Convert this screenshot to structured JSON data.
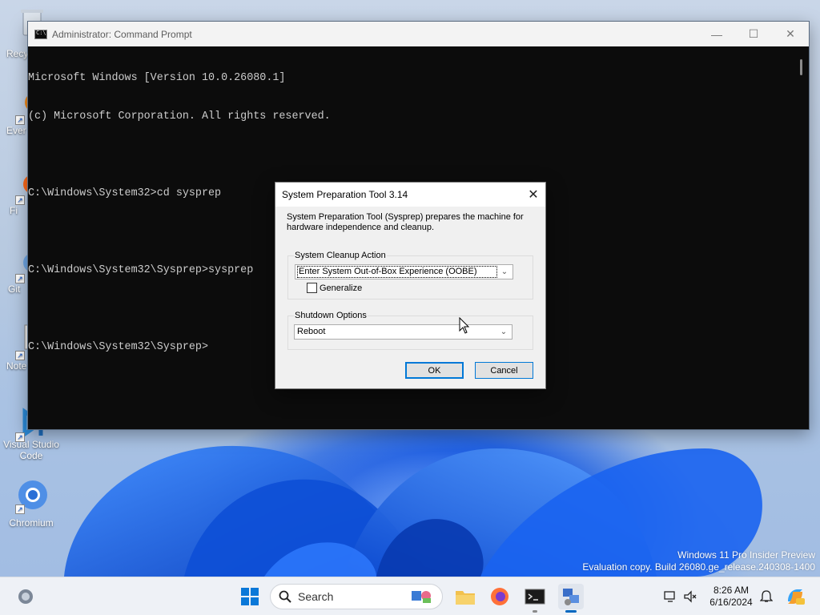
{
  "desktop": {
    "icons": [
      {
        "id": "recycle",
        "label": "Recy"
      },
      {
        "id": "everything",
        "label": "Ever"
      },
      {
        "id": "firefox",
        "label": "Fi"
      },
      {
        "id": "git",
        "label": "Git"
      },
      {
        "id": "notepad",
        "label": "Note"
      },
      {
        "id": "vscode",
        "label": "Visual Studio\nCode"
      },
      {
        "id": "chromium",
        "label": "Chromium"
      }
    ],
    "watermark_line1": "Windows 11 Pro Insider Preview",
    "watermark_line2": "Evaluation copy. Build 26080.ge_release.240308-1400"
  },
  "cmd": {
    "title": "Administrator: Command Prompt",
    "lines": [
      "Microsoft Windows [Version 10.0.26080.1]",
      "(c) Microsoft Corporation. All rights reserved.",
      "",
      "C:\\Windows\\System32>cd sysprep",
      "",
      "C:\\Windows\\System32\\Sysprep>sysprep",
      "",
      "C:\\Windows\\System32\\Sysprep>"
    ],
    "controls": {
      "minimize": "—",
      "maximize": "☐",
      "close": "✕"
    }
  },
  "sysprep": {
    "title": "System Preparation Tool 3.14",
    "close": "✕",
    "description": "System Preparation Tool (Sysprep) prepares the machine for hardware independence and cleanup.",
    "cleanup_group_label": "System Cleanup Action",
    "cleanup_selected": "Enter System Out-of-Box Experience (OOBE)",
    "generalize_label": "Generalize",
    "generalize_checked": false,
    "shutdown_group_label": "Shutdown Options",
    "shutdown_selected": "Reboot",
    "ok_label": "OK",
    "cancel_label": "Cancel"
  },
  "taskbar": {
    "search_label": "Search",
    "time": "8:26 AM",
    "date": "6/16/2024"
  }
}
